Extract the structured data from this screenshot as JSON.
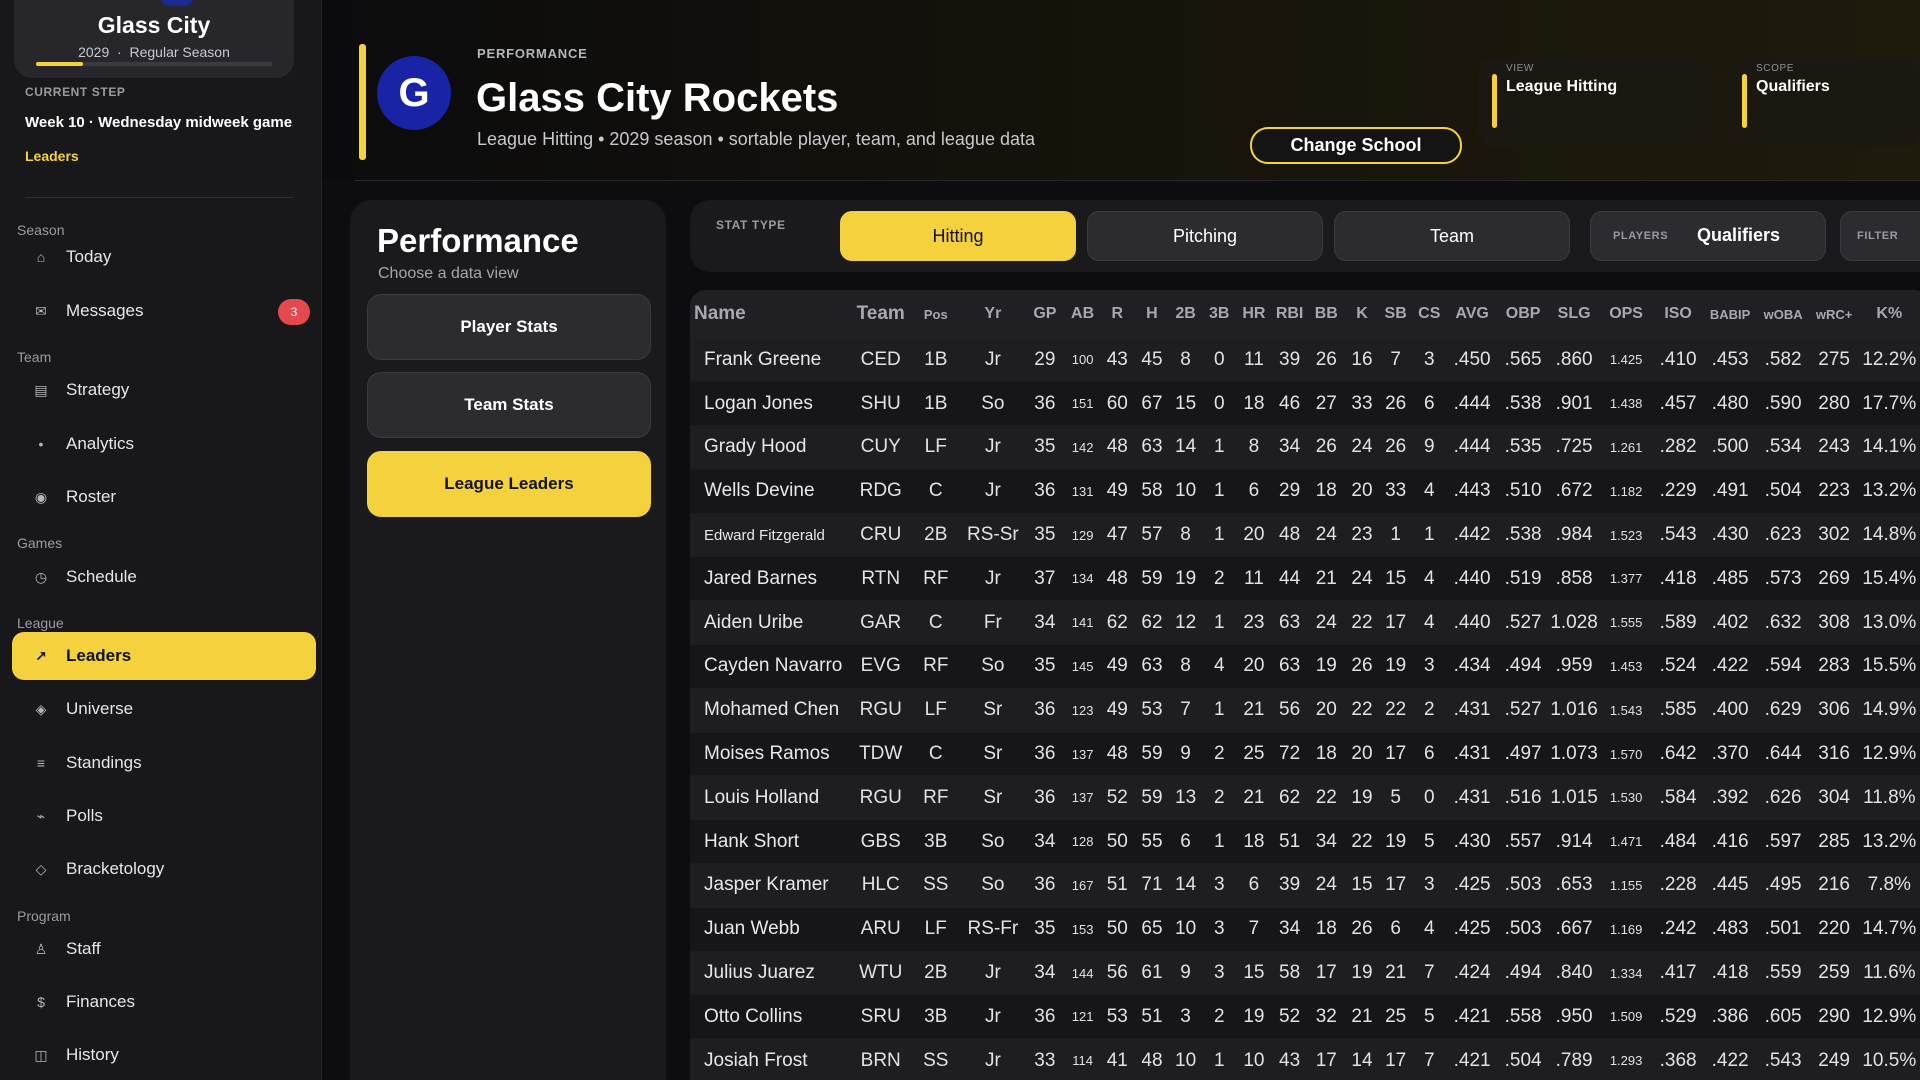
{
  "sidebar": {
    "team_name": "Glass City",
    "season_year": "2029",
    "season_sep": "·",
    "season_phase": "Regular Season",
    "season_progress": 0.2,
    "current_step_label": "CURRENT STEP",
    "current_step_value": "Week 10 · Wednesday midweek game",
    "current_step_link": "Leaders",
    "sections": {
      "season": "Season",
      "team": "Team",
      "games": "Games",
      "league": "League",
      "program": "Program"
    },
    "items": [
      {
        "label": "Today",
        "icon": "⌂",
        "icon_name": "home-icon"
      },
      {
        "label": "Messages",
        "icon": "✉",
        "icon_name": "envelope-icon",
        "badge": "3"
      },
      {
        "label": "Strategy",
        "icon": "▤",
        "icon_name": "clipboard-icon"
      },
      {
        "label": "Analytics",
        "icon": "•",
        "icon_name": "analytics-icon"
      },
      {
        "label": "Roster",
        "icon": "◉",
        "icon_name": "roster-icon"
      },
      {
        "label": "Schedule",
        "icon": "◷",
        "icon_name": "clock-icon"
      },
      {
        "label": "Leaders",
        "icon": "↗",
        "icon_name": "trending-arrow-icon"
      },
      {
        "label": "Universe",
        "icon": "◈",
        "icon_name": "universe-icon"
      },
      {
        "label": "Standings",
        "icon": "≡",
        "icon_name": "list-icon"
      },
      {
        "label": "Polls",
        "icon": "⌁",
        "icon_name": "polls-icon"
      },
      {
        "label": "Bracketology",
        "icon": "◇",
        "icon_name": "diamond-icon"
      },
      {
        "label": "Staff",
        "icon": "♙",
        "icon_name": "person-icon"
      },
      {
        "label": "Finances",
        "icon": "$",
        "icon_name": "dollar-icon"
      },
      {
        "label": "History",
        "icon": "◫",
        "icon_name": "book-icon"
      }
    ]
  },
  "header": {
    "eyebrow": "PERFORMANCE",
    "logo_letter": "G",
    "title": "Glass City Rockets",
    "subtitle": "League Hitting • 2029 season • sortable player, team, and league data",
    "change_school": "Change School",
    "view_label": "VIEW",
    "view_value": "League Hitting",
    "scope_label": "SCOPE",
    "scope_value": "Qualifiers"
  },
  "performance": {
    "title": "Performance",
    "subtitle": "Choose a data view",
    "buttons": [
      "Player Stats",
      "Team Stats",
      "League Leaders"
    ]
  },
  "filters": {
    "stat_type_label": "STAT TYPE",
    "tabs": [
      "Hitting",
      "Pitching",
      "Team"
    ],
    "players_label": "PLAYERS",
    "players_value": "Qualifiers",
    "filter_label": "FILTER"
  },
  "table": {
    "columns": [
      "Name",
      "Team",
      "Pos",
      "Yr",
      "GP",
      "AB",
      "R",
      "H",
      "2B",
      "3B",
      "HR",
      "RBI",
      "BB",
      "K",
      "SB",
      "CS",
      "AVG",
      "OBP",
      "SLG",
      "OPS",
      "ISO",
      "BABIP",
      "wOBA",
      "wRC+",
      "K%"
    ],
    "rows": [
      [
        "Frank Greene",
        "CED",
        "1B",
        "Jr",
        "29",
        "100",
        "43",
        "45",
        "8",
        "0",
        "11",
        "39",
        "26",
        "16",
        "7",
        "3",
        ".450",
        ".565",
        ".860",
        "1.425",
        ".410",
        ".453",
        ".582",
        "275",
        "12.2%"
      ],
      [
        "Logan Jones",
        "SHU",
        "1B",
        "So",
        "36",
        "151",
        "60",
        "67",
        "15",
        "0",
        "18",
        "46",
        "27",
        "33",
        "26",
        "6",
        ".444",
        ".538",
        ".901",
        "1.438",
        ".457",
        ".480",
        ".590",
        "280",
        "17.7%"
      ],
      [
        "Grady Hood",
        "CUY",
        "LF",
        "Jr",
        "35",
        "142",
        "48",
        "63",
        "14",
        "1",
        "8",
        "34",
        "26",
        "24",
        "26",
        "9",
        ".444",
        ".535",
        ".725",
        "1.261",
        ".282",
        ".500",
        ".534",
        "243",
        "14.1%"
      ],
      [
        "Wells Devine",
        "RDG",
        "C",
        "Jr",
        "36",
        "131",
        "49",
        "58",
        "10",
        "1",
        "6",
        "29",
        "18",
        "20",
        "33",
        "4",
        ".443",
        ".510",
        ".672",
        "1.182",
        ".229",
        ".491",
        ".504",
        "223",
        "13.2%"
      ],
      [
        "Edward Fitzgerald",
        "CRU",
        "2B",
        "RS-Sr",
        "35",
        "129",
        "47",
        "57",
        "8",
        "1",
        "20",
        "48",
        "24",
        "23",
        "1",
        "1",
        ".442",
        ".538",
        ".984",
        "1.523",
        ".543",
        ".430",
        ".623",
        "302",
        "14.8%"
      ],
      [
        "Jared Barnes",
        "RTN",
        "RF",
        "Jr",
        "37",
        "134",
        "48",
        "59",
        "19",
        "2",
        "11",
        "44",
        "21",
        "24",
        "15",
        "4",
        ".440",
        ".519",
        ".858",
        "1.377",
        ".418",
        ".485",
        ".573",
        "269",
        "15.4%"
      ],
      [
        "Aiden Uribe",
        "GAR",
        "C",
        "Fr",
        "34",
        "141",
        "62",
        "62",
        "12",
        "1",
        "23",
        "63",
        "24",
        "22",
        "17",
        "4",
        ".440",
        ".527",
        "1.028",
        "1.555",
        ".589",
        ".402",
        ".632",
        "308",
        "13.0%"
      ],
      [
        "Cayden Navarro",
        "EVG",
        "RF",
        "So",
        "35",
        "145",
        "49",
        "63",
        "8",
        "4",
        "20",
        "63",
        "19",
        "26",
        "19",
        "3",
        ".434",
        ".494",
        ".959",
        "1.453",
        ".524",
        ".422",
        ".594",
        "283",
        "15.5%"
      ],
      [
        "Mohamed Chen",
        "RGU",
        "LF",
        "Sr",
        "36",
        "123",
        "49",
        "53",
        "7",
        "1",
        "21",
        "56",
        "20",
        "22",
        "22",
        "2",
        ".431",
        ".527",
        "1.016",
        "1.543",
        ".585",
        ".400",
        ".629",
        "306",
        "14.9%"
      ],
      [
        "Moises Ramos",
        "TDW",
        "C",
        "Sr",
        "36",
        "137",
        "48",
        "59",
        "9",
        "2",
        "25",
        "72",
        "18",
        "20",
        "17",
        "6",
        ".431",
        ".497",
        "1.073",
        "1.570",
        ".642",
        ".370",
        ".644",
        "316",
        "12.9%"
      ],
      [
        "Louis Holland",
        "RGU",
        "RF",
        "Sr",
        "36",
        "137",
        "52",
        "59",
        "13",
        "2",
        "21",
        "62",
        "22",
        "19",
        "5",
        "0",
        ".431",
        ".516",
        "1.015",
        "1.530",
        ".584",
        ".392",
        ".626",
        "304",
        "11.8%"
      ],
      [
        "Hank Short",
        "GBS",
        "3B",
        "So",
        "34",
        "128",
        "50",
        "55",
        "6",
        "1",
        "18",
        "51",
        "34",
        "22",
        "19",
        "5",
        ".430",
        ".557",
        ".914",
        "1.471",
        ".484",
        ".416",
        ".597",
        "285",
        "13.2%"
      ],
      [
        "Jasper Kramer",
        "HLC",
        "SS",
        "So",
        "36",
        "167",
        "51",
        "71",
        "14",
        "3",
        "6",
        "39",
        "24",
        "15",
        "17",
        "3",
        ".425",
        ".503",
        ".653",
        "1.155",
        ".228",
        ".445",
        ".495",
        "216",
        "7.8%"
      ],
      [
        "Juan Webb",
        "ARU",
        "LF",
        "RS-Fr",
        "35",
        "153",
        "50",
        "65",
        "10",
        "3",
        "7",
        "34",
        "18",
        "26",
        "6",
        "4",
        ".425",
        ".503",
        ".667",
        "1.169",
        ".242",
        ".483",
        ".501",
        "220",
        "14.7%"
      ],
      [
        "Julius Juarez",
        "WTU",
        "2B",
        "Jr",
        "34",
        "144",
        "56",
        "61",
        "9",
        "3",
        "15",
        "58",
        "17",
        "19",
        "21",
        "7",
        ".424",
        ".494",
        ".840",
        "1.334",
        ".417",
        ".418",
        ".559",
        "259",
        "11.6%"
      ],
      [
        "Otto Collins",
        "SRU",
        "3B",
        "Jr",
        "36",
        "121",
        "53",
        "51",
        "3",
        "2",
        "19",
        "52",
        "32",
        "21",
        "25",
        "5",
        ".421",
        ".558",
        ".950",
        "1.509",
        ".529",
        ".386",
        ".605",
        "290",
        "12.9%"
      ],
      [
        "Josiah Frost",
        "BRN",
        "SS",
        "Jr",
        "33",
        "114",
        "41",
        "48",
        "10",
        "1",
        "10",
        "43",
        "17",
        "14",
        "17",
        "7",
        ".421",
        ".504",
        ".789",
        "1.293",
        ".368",
        ".422",
        ".543",
        "249",
        "10.5%"
      ]
    ]
  },
  "colors": {
    "accent": "#f5d13d",
    "badge": "#e5484d",
    "logo": "#1923a6"
  }
}
